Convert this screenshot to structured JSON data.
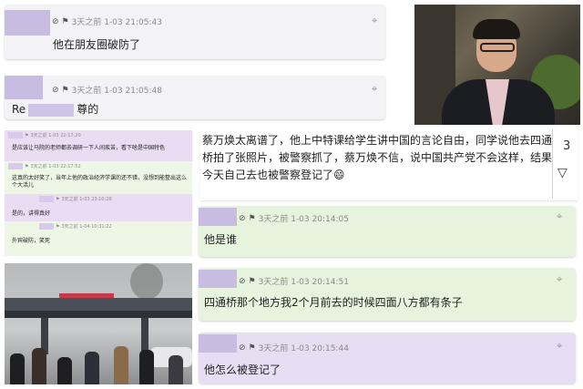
{
  "top_chat": [
    {
      "meta": "3天之前 1-03 21:05:43",
      "message": "他在朋友圈破防了"
    },
    {
      "meta": "3天之前 1-03 21:05:48",
      "message_prefix": "Re",
      "message_suffix": "尊的"
    }
  ],
  "mini_log": [
    {
      "meta": "3天之前 1-03 22:17:20",
      "text": "是应该让马院的老师都去调研一下人间疾苦，看下啥是中国特色"
    },
    {
      "meta": "3天之前 1-03 22:17:52",
      "text": "这真的太好笑了，当年上他的政治经济学课的还不错，没想到能整出这么个大活儿"
    },
    {
      "meta": "3天之前 1-03 23:10:28",
      "text": "是的，讲得真好"
    },
    {
      "meta": "3天之前 1-04 10:31:22",
      "text": "外宾破防，笑死"
    }
  ],
  "big_message": {
    "text": "蔡万焕太离谱了，他上中特课给学生讲中国的言论自由，同学说他去四通桥拍了张照片，被警察抓了，蔡万焕不信，说中国共产党不会这样，结果今天自己去也被警察登记了😄",
    "count": "3"
  },
  "right_chat": [
    {
      "meta": "3天之前 1-03 20:14:05",
      "message": "他是谁"
    },
    {
      "meta": "3天之前 1-03 20:14:51",
      "message": "四通桥那个地方我2个月前去的时候四面八方都有条子"
    },
    {
      "meta": "3天之前 1-03 20:15:44",
      "message": "他怎么被登记了"
    }
  ],
  "icons": {
    "block": "block-icon",
    "flag": "flag-icon",
    "target": "crosshair-icon"
  },
  "colors": {
    "avatar": "#c9bce3",
    "card_gray": "#f3f2f5",
    "card_lilac": "#e7def3",
    "card_mint": "#e6f4de"
  }
}
